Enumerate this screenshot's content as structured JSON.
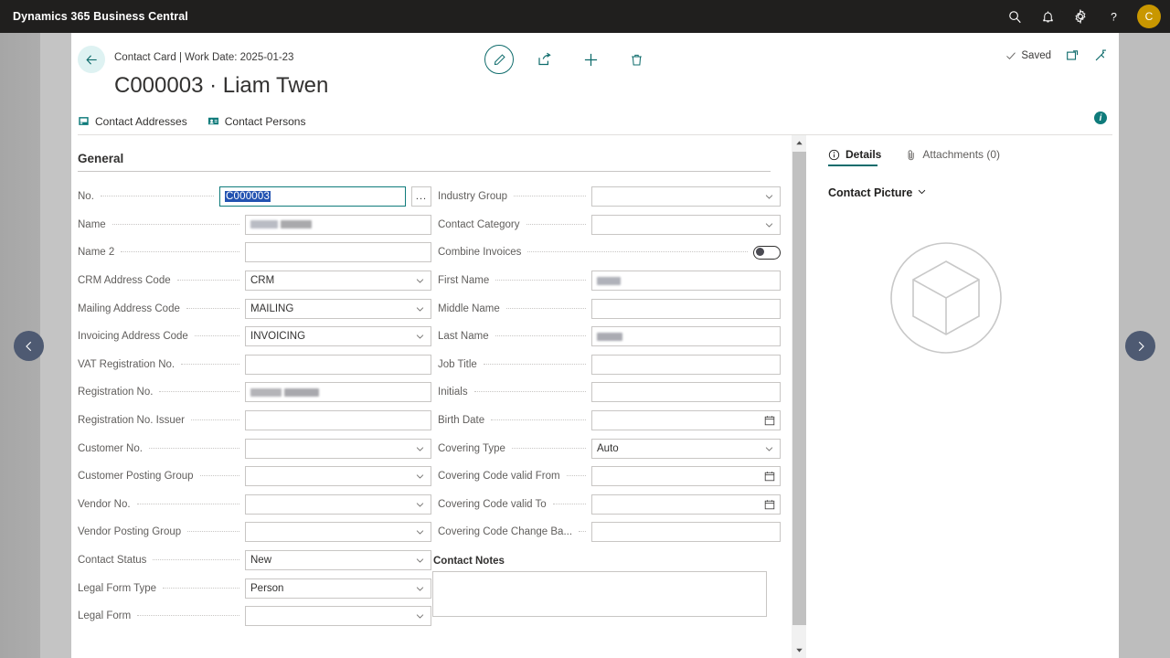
{
  "topbar": {
    "app_title": "Dynamics 365 Business Central",
    "search_icon": "search-icon",
    "notifications_icon": "bell-icon",
    "settings_icon": "gear-icon",
    "help_icon": "question-mark-icon",
    "avatar_initial": "C",
    "avatar_color": "#c99700"
  },
  "header": {
    "back_icon": "arrow-left-icon",
    "breadcrumb": "Contact Card | Work Date: 2025-01-23",
    "title": "C000003 · Liam Twen",
    "actions": [
      {
        "name": "edit-action",
        "icon": "pencil-icon"
      },
      {
        "name": "share-action",
        "icon": "share-icon"
      },
      {
        "name": "new-action",
        "icon": "plus-icon"
      },
      {
        "name": "delete-action",
        "icon": "trash-icon"
      }
    ],
    "saved_label": "Saved",
    "saved_icon": "checkmark-icon",
    "open-new-window_icon": "open-in-new-window-icon",
    "collapse_icon": "collapse-icon",
    "accent_color": "#0f6c6c"
  },
  "navstrip": {
    "links": [
      {
        "label": "Contact Addresses",
        "icon": "address-book-icon"
      },
      {
        "label": "Contact Persons",
        "icon": "contact-card-icon"
      }
    ],
    "info_badge": "i"
  },
  "form": {
    "section_title": "General",
    "left_fields": [
      {
        "label": "No.",
        "value": "C000003",
        "type": "text",
        "focused": true,
        "selected": true,
        "assist": "..."
      },
      {
        "label": "Name",
        "value": "",
        "type": "text",
        "redacted": [
          30,
          34
        ]
      },
      {
        "label": "Name 2",
        "value": "",
        "type": "text"
      },
      {
        "label": "CRM Address Code",
        "value": "CRM",
        "type": "dropdown"
      },
      {
        "label": "Mailing Address Code",
        "value": "MAILING",
        "type": "dropdown"
      },
      {
        "label": "Invoicing Address Code",
        "value": "INVOICING",
        "type": "dropdown"
      },
      {
        "label": "VAT Registration No.",
        "value": "",
        "type": "text"
      },
      {
        "label": "Registration No.",
        "value": "",
        "type": "text",
        "redacted": [
          34,
          38
        ]
      },
      {
        "label": "Registration No. Issuer",
        "value": "",
        "type": "text"
      },
      {
        "label": "Customer No.",
        "value": "",
        "type": "dropdown"
      },
      {
        "label": "Customer Posting Group",
        "value": "",
        "type": "dropdown"
      },
      {
        "label": "Vendor No.",
        "value": "",
        "type": "dropdown"
      },
      {
        "label": "Vendor Posting Group",
        "value": "",
        "type": "dropdown"
      },
      {
        "label": "Contact Status",
        "value": "New",
        "type": "dropdown"
      },
      {
        "label": "Legal Form Type",
        "value": "Person",
        "type": "dropdown"
      },
      {
        "label": "Legal Form",
        "value": "",
        "type": "dropdown"
      }
    ],
    "right_fields": [
      {
        "label": "Industry Group",
        "value": "",
        "type": "dropdown"
      },
      {
        "label": "Contact Category",
        "value": "",
        "type": "dropdown"
      },
      {
        "label": "Combine Invoices",
        "value": "off",
        "type": "toggle"
      },
      {
        "label": "First Name",
        "value": "",
        "type": "text",
        "redacted": [
          26
        ]
      },
      {
        "label": "Middle Name",
        "value": "",
        "type": "text"
      },
      {
        "label": "Last Name",
        "value": "",
        "type": "text",
        "redacted": [
          28
        ]
      },
      {
        "label": "Job Title",
        "value": "",
        "type": "text"
      },
      {
        "label": "Initials",
        "value": "",
        "type": "text"
      },
      {
        "label": "Birth Date",
        "value": "",
        "type": "date"
      },
      {
        "label": "Covering Type",
        "value": "Auto",
        "type": "dropdown"
      },
      {
        "label": "Covering Code valid From",
        "value": "",
        "type": "date"
      },
      {
        "label": "Covering Code valid To",
        "value": "",
        "type": "date"
      },
      {
        "label": "Covering Code Change Ba...",
        "value": "",
        "type": "text"
      }
    ],
    "notes_label": "Contact Notes",
    "notes_value": ""
  },
  "factbox": {
    "tabs": [
      {
        "label": "Details",
        "icon": "info-circle-icon",
        "active": true
      },
      {
        "label": "Attachments (0)",
        "icon": "paperclip-icon",
        "active": false
      }
    ],
    "section_label": "Contact Picture",
    "section_chevron": "chevron-down-icon",
    "placeholder_icon": "cube-placeholder-icon"
  },
  "pagenav": {
    "prev_icon": "chevron-left-icon",
    "next_icon": "chevron-right-icon"
  },
  "scrollbar": {
    "up_icon": "caret-up-icon",
    "down_icon": "caret-down-icon"
  }
}
